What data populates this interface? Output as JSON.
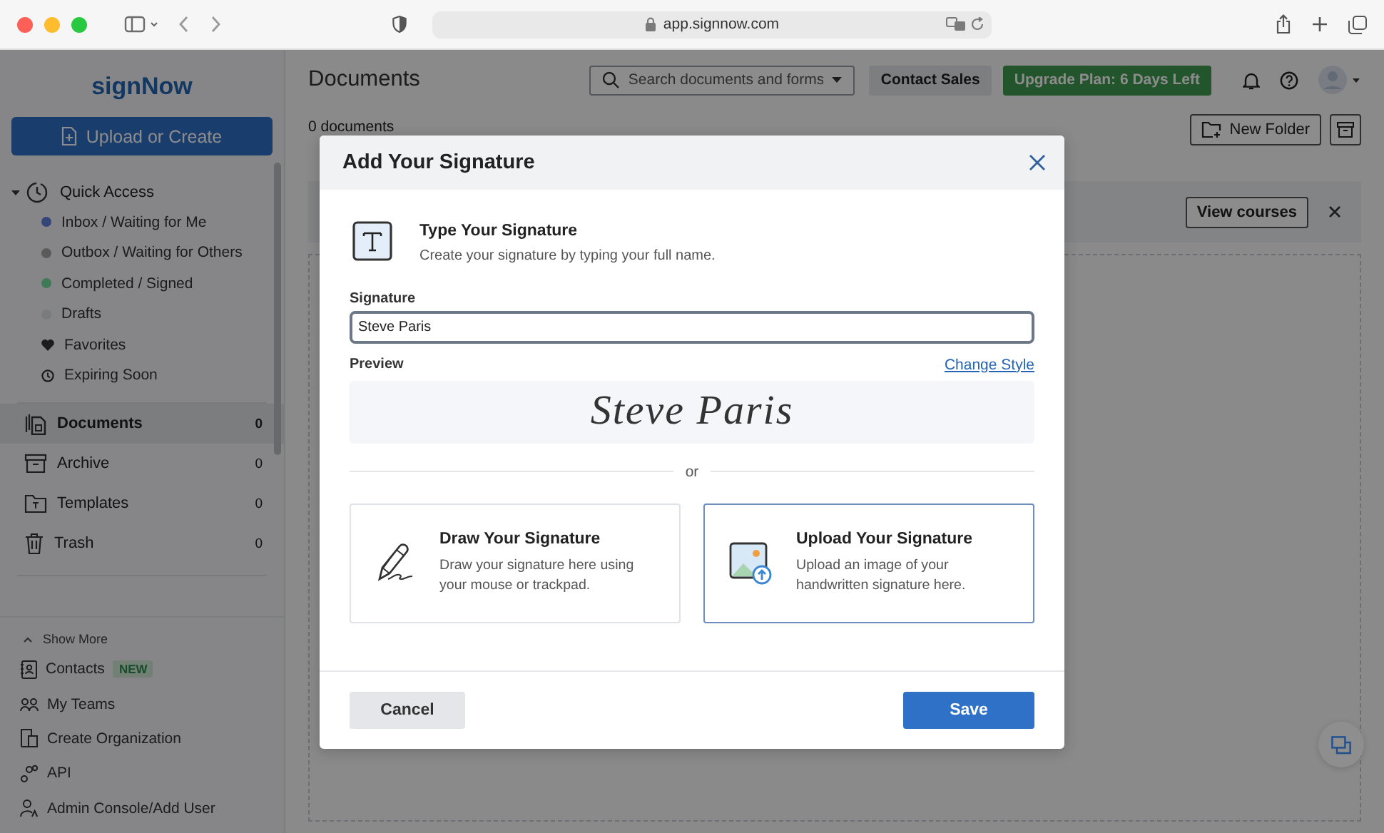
{
  "browser": {
    "url": "app.signnow.com"
  },
  "sidebar": {
    "logo": "signNow",
    "upload_button": "Upload or Create",
    "quick_access": {
      "label": "Quick Access",
      "expanded": true,
      "items": [
        {
          "label": "Inbox / Waiting for Me",
          "kind": "dot",
          "color": "#34457a"
        },
        {
          "label": "Outbox / Waiting for Others",
          "kind": "dot",
          "color": "#5a5a5a"
        },
        {
          "label": "Completed / Signed",
          "kind": "dot",
          "color": "#3e7a56"
        },
        {
          "label": "Drafts",
          "kind": "dot",
          "color": "#7a7b7d"
        },
        {
          "label": "Favorites",
          "kind": "heart"
        },
        {
          "label": "Expiring Soon",
          "kind": "clock"
        }
      ]
    },
    "nav": [
      {
        "label": "Documents",
        "count": "0",
        "selected": true
      },
      {
        "label": "Archive",
        "count": "0",
        "selected": false
      },
      {
        "label": "Templates",
        "count": "0",
        "selected": false
      },
      {
        "label": "Trash",
        "count": "0",
        "selected": false
      }
    ],
    "show_more": "Show More",
    "links": [
      {
        "label": "Contacts",
        "badge": "NEW"
      },
      {
        "label": "My Teams"
      },
      {
        "label": "Create Organization"
      },
      {
        "label": "API"
      },
      {
        "label": "Admin Console/Add User"
      }
    ]
  },
  "header": {
    "title": "Documents",
    "search": {
      "placeholder": "Search documents and forms"
    },
    "contact_button": "Contact Sales",
    "upgrade_button": "Upgrade Plan: 6 Days Left"
  },
  "toolbar": {
    "count": "0 documents",
    "new_folder": "New Folder"
  },
  "banner": {
    "button": "View courses"
  },
  "dialog": {
    "title": "Add Your Signature",
    "type_heading": "Type Your Signature",
    "type_description": "Create your signature by typing your full name.",
    "field_label": "Signature",
    "value": "Steve Paris",
    "preview_label": "Preview",
    "change_style": "Change Style",
    "preview": "Steve Paris",
    "separator": "or",
    "options": [
      {
        "title": "Draw Your Signature",
        "description": "Draw your signature here using your mouse or trackpad.",
        "selected": false
      },
      {
        "title": "Upload Your Signature",
        "description": "Upload an image of your handwritten signature here.",
        "selected": true
      }
    ],
    "cancel": "Cancel",
    "save": "Save"
  }
}
